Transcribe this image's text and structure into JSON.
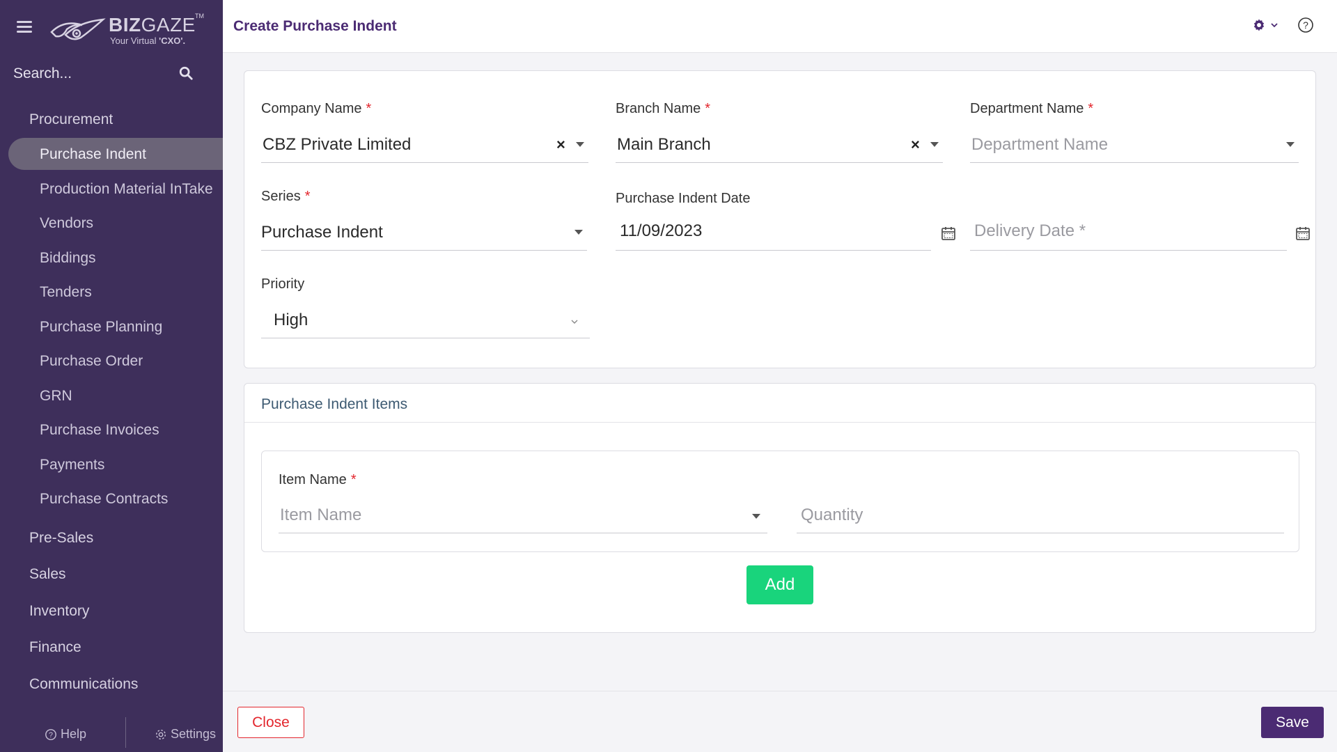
{
  "brand": {
    "name_bold": "BIZ",
    "name_light": "GAZE",
    "trademark": "TM",
    "tagline_prefix": "Your Virtual ",
    "tagline_bold": "'CXO'."
  },
  "search": {
    "placeholder": "Search..."
  },
  "sidebar": {
    "sections": [
      {
        "label": "Procurement"
      },
      {
        "label": "Pre-Sales"
      },
      {
        "label": "Sales"
      },
      {
        "label": "Inventory"
      },
      {
        "label": "Finance"
      },
      {
        "label": "Communications"
      }
    ],
    "procurement_items": [
      {
        "label": "Purchase Indent",
        "active": true
      },
      {
        "label": "Production Material InTake"
      },
      {
        "label": "Vendors"
      },
      {
        "label": "Biddings"
      },
      {
        "label": "Tenders"
      },
      {
        "label": "Purchase Planning"
      },
      {
        "label": "Purchase Order"
      },
      {
        "label": "GRN"
      },
      {
        "label": "Purchase Invoices"
      },
      {
        "label": "Payments"
      },
      {
        "label": "Purchase Contracts"
      }
    ],
    "footer": {
      "help_label": "Help",
      "settings_label": "Settings"
    }
  },
  "header": {
    "title": "Create Purchase Indent"
  },
  "form": {
    "company": {
      "label": "Company Name",
      "required": "*",
      "value": "CBZ Private Limited"
    },
    "branch": {
      "label": "Branch Name",
      "required": "*",
      "value": "Main Branch"
    },
    "department": {
      "label": "Department Name",
      "required": "*",
      "placeholder": "Department Name"
    },
    "series": {
      "label": "Series",
      "required": "*",
      "value": "Purchase Indent"
    },
    "indent_date": {
      "label": "Purchase Indent Date",
      "value": "11/09/2023"
    },
    "delivery_date": {
      "placeholder": "Delivery Date *"
    },
    "priority": {
      "label": "Priority",
      "value": "High"
    }
  },
  "items_section": {
    "title": "Purchase Indent Items",
    "item_name": {
      "label": "Item Name",
      "required": "*",
      "placeholder": "Item Name"
    },
    "quantity": {
      "placeholder": "Quantity"
    },
    "add_label": "Add"
  },
  "actions": {
    "close_label": "Close",
    "save_label": "Save"
  },
  "colors": {
    "sidebar_bg": "#3e2f5b",
    "active_item_bg": "#6b6478",
    "brand_purple": "#4b2b73",
    "add_green": "#19d47c",
    "required_red": "#e3262d"
  }
}
